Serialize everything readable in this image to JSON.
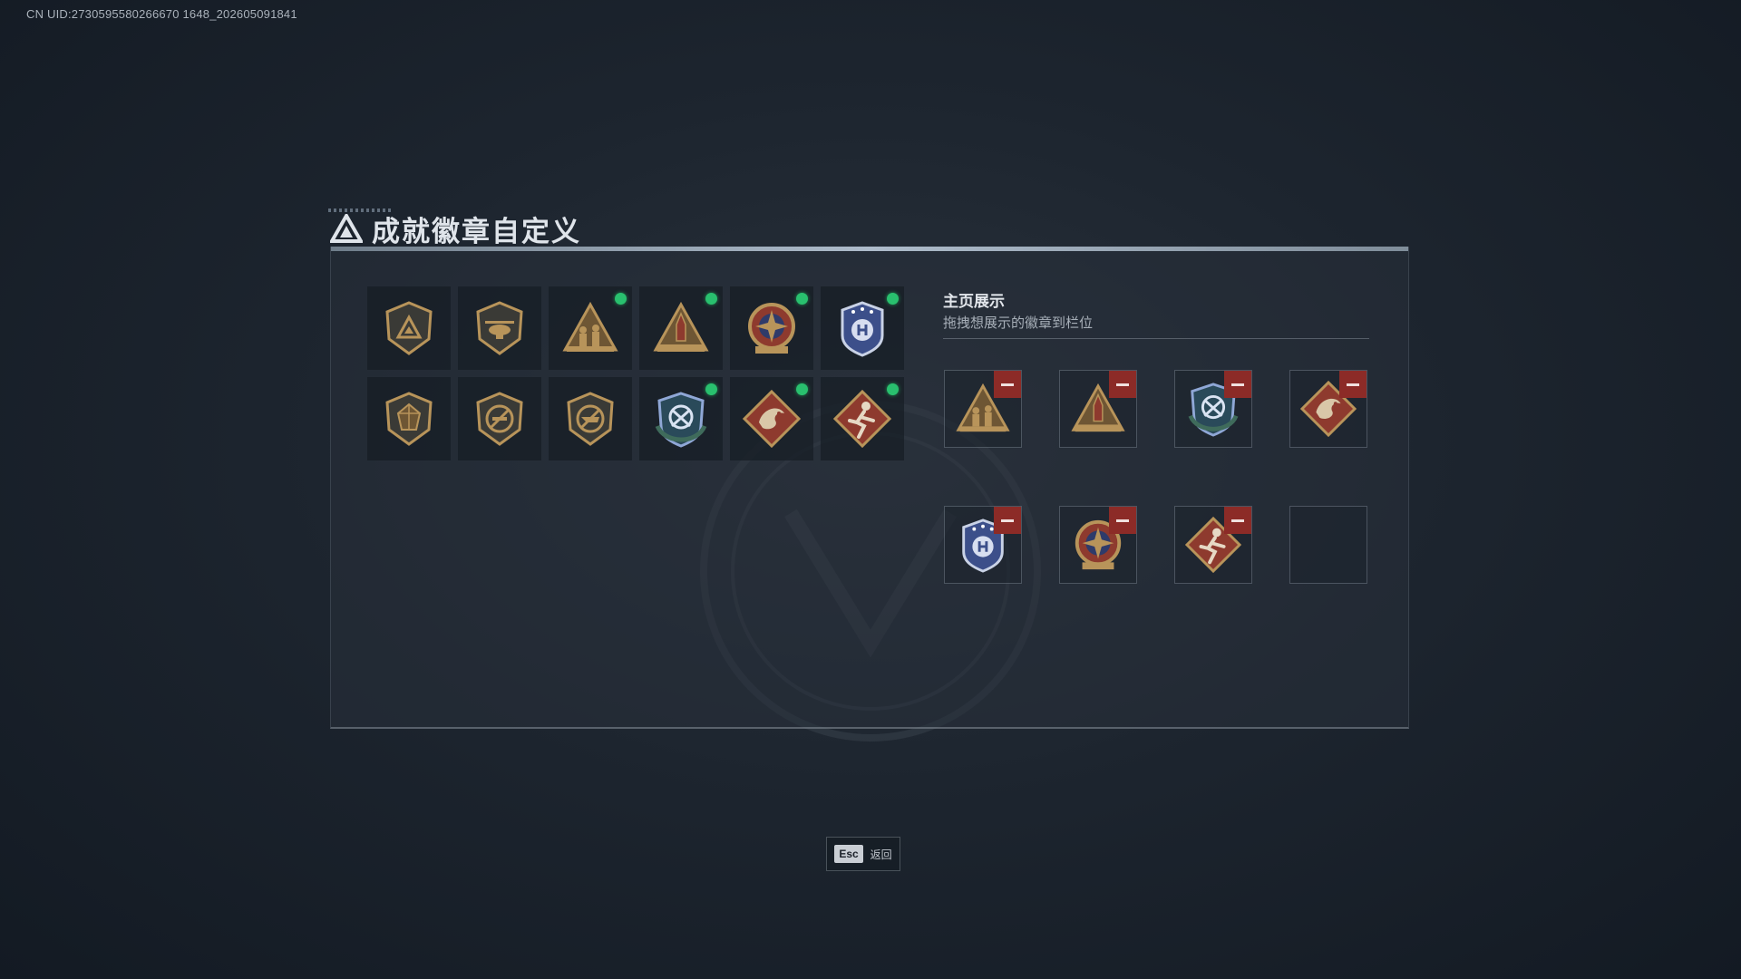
{
  "uid": "CN UID:2730595580266670 1648_202605091841",
  "title": "成就徽章自定义",
  "showcase": {
    "title": "主页展示",
    "subtitle": "拖拽想展示的徽章到栏位"
  },
  "badges": [
    {
      "icon": "triangle-shield-badge",
      "equipped": false
    },
    {
      "icon": "helicopter-shield-badge",
      "equipped": false
    },
    {
      "icon": "soldiers-triangle-badge",
      "equipped": true
    },
    {
      "icon": "rocket-triangle-badge",
      "equipped": true
    },
    {
      "icon": "star-compass-badge",
      "equipped": true
    },
    {
      "icon": "blue-police-badge",
      "equipped": true
    },
    {
      "icon": "gem-shield-badge",
      "equipped": false
    },
    {
      "icon": "no-weapon-shield-badge",
      "equipped": false
    },
    {
      "icon": "no-rifle-shield-badge",
      "equipped": false
    },
    {
      "icon": "green-blue-shield-badge",
      "equipped": true
    },
    {
      "icon": "dragon-diamond-badge",
      "equipped": true
    },
    {
      "icon": "runner-diamond-badge",
      "equipped": true
    }
  ],
  "slots": [
    {
      "icon": "soldiers-triangle-badge",
      "filled": true
    },
    {
      "icon": "rocket-triangle-badge",
      "filled": true
    },
    {
      "icon": "green-blue-shield-badge",
      "filled": true
    },
    {
      "icon": "dragon-diamond-badge",
      "filled": true
    },
    {
      "icon": "blue-police-badge",
      "filled": true
    },
    {
      "icon": "star-compass-badge",
      "filled": true
    },
    {
      "icon": "runner-diamond-badge",
      "filled": true
    },
    {
      "icon": "",
      "filled": false
    }
  ],
  "footer": {
    "esc_key": "Esc",
    "esc_label": "返回"
  },
  "colors": {
    "equipped_dot": "#29c06e",
    "remove_button": "#8c2b27",
    "badge_gold": "#b8945a",
    "badge_red": "#8e3a2e",
    "badge_blue": "#3c4f8a"
  }
}
